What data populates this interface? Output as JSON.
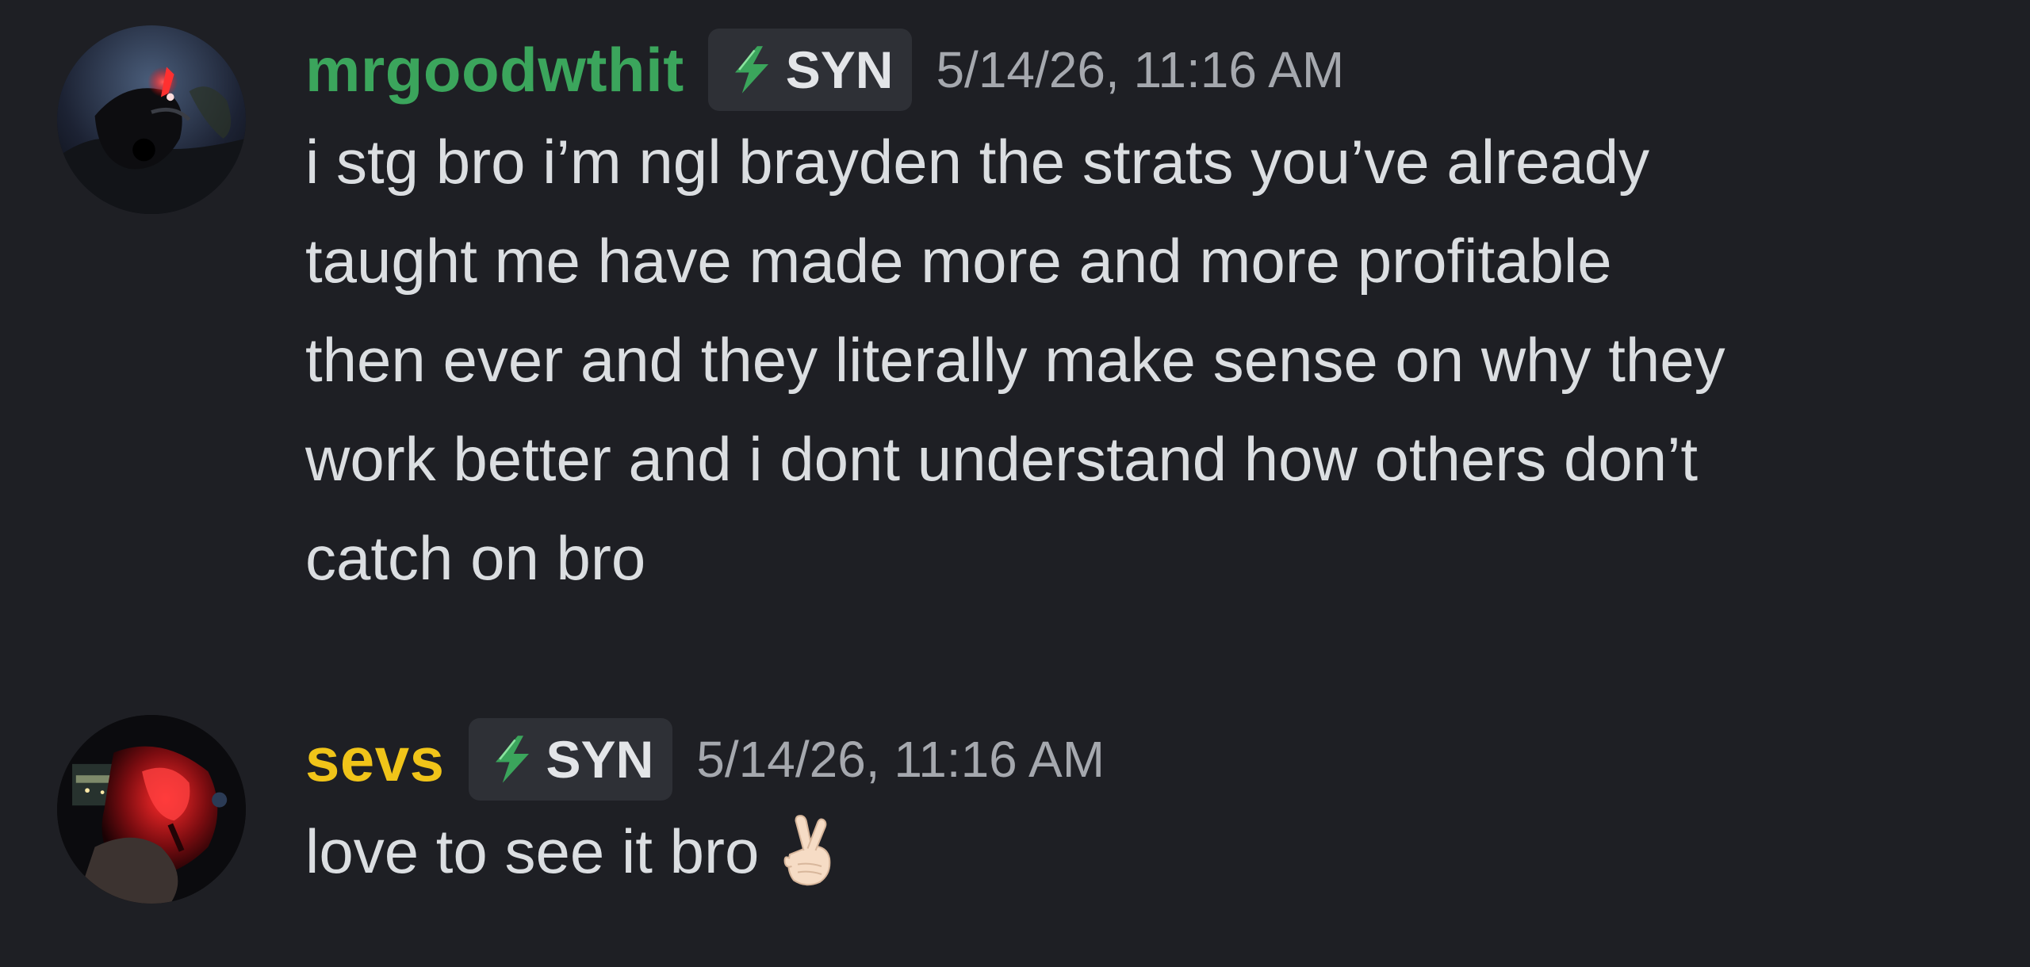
{
  "messages": [
    {
      "username": "mrgoodwthit",
      "username_color": "#3ba55c",
      "tag_label": "SYN",
      "tag_icon": "lightning-bolt-icon",
      "timestamp": "5/14/26, 11:16 AM",
      "avatar": "motorcycle-avatar",
      "lines": [
        "i stg bro i’m ngl brayden the strats you’ve already",
        "taught me have made more and more profitable",
        "then ever and they literally make sense on why they",
        "work better and i dont understand how others don’t",
        "catch on bro"
      ]
    },
    {
      "username": "sevs",
      "username_color": "#f0c419",
      "tag_label": "SYN",
      "tag_icon": "lightning-bolt-icon",
      "timestamp": "5/14/26, 11:16 AM",
      "avatar": "car-interior-avatar",
      "text": "love to see it bro",
      "emoji": "crossed-fingers-emoji"
    }
  ],
  "colors": {
    "background": "#1e1f24",
    "tag_background": "#2e3036",
    "timestamp": "#a5a8ae",
    "message_text": "#dbdee1",
    "bolt": "#3ba55c"
  }
}
